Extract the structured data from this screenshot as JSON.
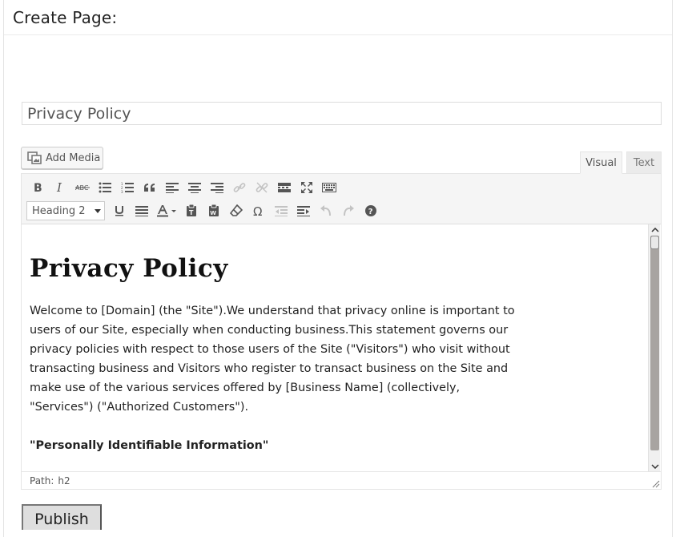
{
  "page": {
    "title": "Create Page:"
  },
  "post_title": {
    "value": "Privacy Policy"
  },
  "media": {
    "add_media_label": "Add Media"
  },
  "tabs": {
    "visual_label": "Visual",
    "text_label": "Text"
  },
  "toolbar": {
    "format_select_value": "Heading 2",
    "row1_icons": [
      "bold-icon",
      "italic-icon",
      "strikethrough-icon",
      "bulleted-list-icon",
      "numbered-list-icon",
      "blockquote-icon",
      "align-left-icon",
      "align-center-icon",
      "align-right-icon",
      "insert-link-icon",
      "remove-link-icon",
      "read-more-icon",
      "fullscreen-icon",
      "toolbar-toggle-icon"
    ],
    "row2_icons": [
      "underline-icon",
      "justify-icon",
      "text-color-icon",
      "paste-as-text-icon",
      "paste-from-word-icon",
      "clear-formatting-icon",
      "special-character-icon",
      "outdent-icon",
      "indent-icon",
      "undo-icon",
      "redo-icon",
      "help-icon"
    ]
  },
  "content": {
    "heading": "Privacy Policy",
    "paragraph": "Welcome to [Domain] (the \"Site\").We understand that privacy online is important to users of our Site, especially when conducting business.This statement governs our privacy policies with respect to those users of the Site (\"Visitors\") who visit without transacting business and Visitors who register to transact business on the Site and make use of the various services offered by [Business Name] (collectively, \"Services\") (\"Authorized Customers\").",
    "subheading": "\"Personally Identifiable Information\""
  },
  "status_bar": {
    "path_label": "Path:",
    "path_value": "h2"
  },
  "actions": {
    "publish_label": "Publish"
  },
  "colors": {
    "toolbar_bg": "#f5f5f5",
    "icon": "#555555",
    "icon_disabled": "#c3c3c3",
    "scroll_track": "#a8a4a1",
    "publish_bg": "#dedede"
  }
}
